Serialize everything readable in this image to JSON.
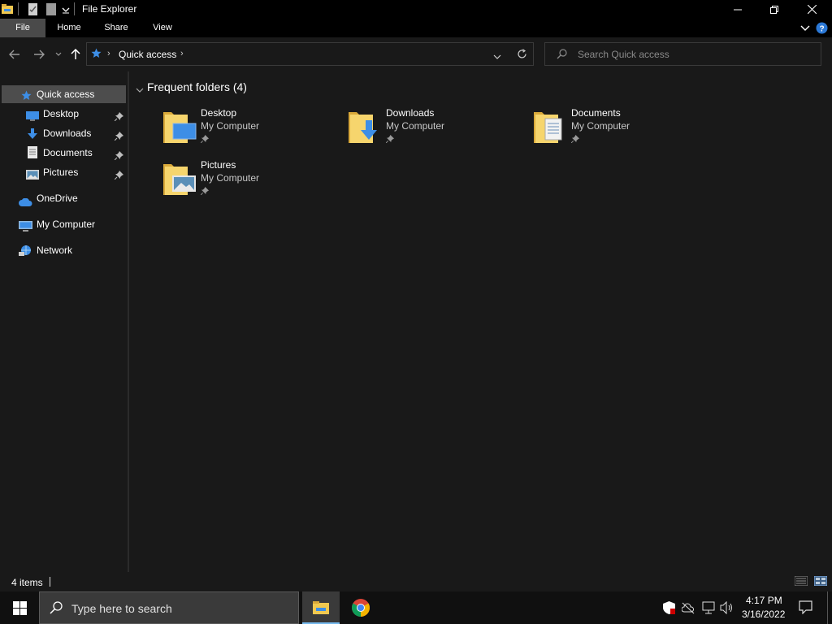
{
  "window": {
    "title": "File Explorer"
  },
  "ribbon": {
    "tabs": [
      "File",
      "Home",
      "Share",
      "View"
    ]
  },
  "address": {
    "crumb": "Quick access",
    "search_placeholder": "Search Quick access"
  },
  "sidebar": {
    "quick_access": "Quick access",
    "items": [
      {
        "label": "Desktop",
        "icon": "desktop-icon",
        "pinned": true
      },
      {
        "label": "Downloads",
        "icon": "download-icon",
        "pinned": true
      },
      {
        "label": "Documents",
        "icon": "documents-icon",
        "pinned": true
      },
      {
        "label": "Pictures",
        "icon": "pictures-icon",
        "pinned": true
      }
    ],
    "onedrive": "OneDrive",
    "my_computer": "My Computer",
    "network": "Network"
  },
  "content": {
    "group_title": "Frequent folders (4)",
    "folders": [
      {
        "name": "Desktop",
        "location": "My Computer"
      },
      {
        "name": "Downloads",
        "location": "My Computer"
      },
      {
        "name": "Documents",
        "location": "My Computer"
      },
      {
        "name": "Pictures",
        "location": "My Computer"
      }
    ]
  },
  "status": {
    "items": "4 items"
  },
  "taskbar": {
    "search_placeholder": "Type here to search",
    "time": "4:17 PM",
    "date": "3/16/2022"
  },
  "colors": {
    "accent": "#3d8ee6",
    "folder": "#f0c850",
    "background": "#191919",
    "chrome": "#000000"
  }
}
